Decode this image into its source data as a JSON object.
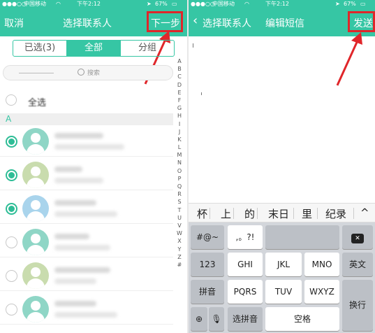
{
  "left": {
    "status": {
      "carrier": "中国移动",
      "time": "下午2:12",
      "battery": "67%"
    },
    "nav": {
      "cancel": "取消",
      "title": "选择联系人",
      "next": "下一步"
    },
    "tabs": [
      "已选(3)",
      "全部",
      "分组"
    ],
    "search_placeholder": "搜索",
    "select_all": "全选",
    "section": "A",
    "alphabet": [
      "A",
      "B",
      "C",
      "D",
      "E",
      "F",
      "G",
      "H",
      "I",
      "J",
      "K",
      "L",
      "M",
      "N",
      "O",
      "P",
      "Q",
      "R",
      "S",
      "T",
      "U",
      "V",
      "W",
      "X",
      "Y",
      "Z",
      "#"
    ],
    "contacts": [
      {
        "checked": true,
        "color": "#8fd6c6"
      },
      {
        "checked": true,
        "color": "#c9dcae"
      },
      {
        "checked": true,
        "color": "#a9d4ec"
      },
      {
        "checked": false,
        "color": "#8fd6c6"
      },
      {
        "checked": false,
        "color": "#c9dcae"
      },
      {
        "checked": false,
        "color": "#8fd6c6"
      }
    ]
  },
  "right": {
    "status": {
      "carrier": "中国移动",
      "time": "下午2:12",
      "battery": "67%"
    },
    "nav": {
      "back": "选择联系人",
      "title": "编辑短信",
      "send": "发送"
    },
    "suggestions": [
      "杯",
      "上",
      "的",
      "末日",
      "里",
      "纪录",
      "^"
    ],
    "keys": {
      "symbols": "#@~",
      "punct": ",。?!",
      "num": "123",
      "ghi": "GHI",
      "jkl": "JKL",
      "mno": "MNO",
      "english": "英文",
      "pinyin": "拼音",
      "pqrs": "PQRS",
      "tuv": "TUV",
      "wxyz": "WXYZ",
      "newline": "换行",
      "select_pinyin": "选拼音",
      "space": "空格",
      "delete": "✕"
    }
  },
  "colors": {
    "accent": "#36c6a4",
    "highlight": "#e0262a"
  }
}
